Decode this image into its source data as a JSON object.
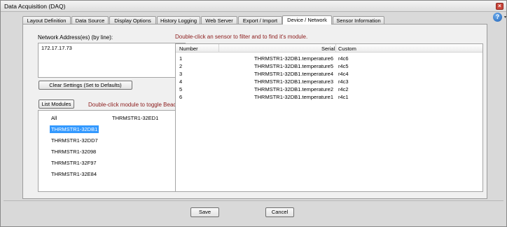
{
  "window": {
    "title": "Data Acquisition (DAQ)",
    "close_glyph": "×",
    "help_glyph": "?",
    "help_caret": "▾"
  },
  "tabs": [
    {
      "label": "Layout Definition"
    },
    {
      "label": "Data Source"
    },
    {
      "label": "Display Options"
    },
    {
      "label": "History Logging"
    },
    {
      "label": "Web Server"
    },
    {
      "label": "Export / Import"
    },
    {
      "label": "Device / Network",
      "active": true
    },
    {
      "label": "Sensor Information"
    }
  ],
  "network": {
    "label": "Network Address(es) (by line):",
    "value": "172.17.17.73",
    "clear_button": "Clear Settings (Set to Defaults)"
  },
  "modules": {
    "list_button": "List Modules",
    "hint": "Double-click module to toggle Beacon.",
    "items_col1": [
      "All",
      "THRMSTR1-32DB1",
      "THRMSTR1-32DD7",
      "THRMSTR1-32098",
      "THRMSTR1-32F97",
      "THRMSTR1-32E84"
    ],
    "items_col2": [
      "THRMSTR1-32ED1"
    ],
    "selected": "THRMSTR1-32DB1"
  },
  "sensors": {
    "hint": "Double-click an sensor to filter and to find it's module.",
    "columns": [
      "Number",
      "Serial",
      "Custom"
    ],
    "rows": [
      {
        "number": "1",
        "serial": "THRMSTR1-32DB1.temperature6",
        "custom": "r4c6"
      },
      {
        "number": "2",
        "serial": "THRMSTR1-32DB1.temperature5",
        "custom": "r4c5"
      },
      {
        "number": "3",
        "serial": "THRMSTR1-32DB1.temperature4",
        "custom": "r4c4"
      },
      {
        "number": "4",
        "serial": "THRMSTR1-32DB1.temperature3",
        "custom": "r4c3"
      },
      {
        "number": "5",
        "serial": "THRMSTR1-32DB1.temperature2",
        "custom": "r4c2"
      },
      {
        "number": "6",
        "serial": "THRMSTR1-32DB1.temperature1",
        "custom": "r4c1"
      }
    ]
  },
  "footer": {
    "save": "Save",
    "cancel": "Cancel"
  },
  "colors": {
    "hint_text": "#8b1a1a",
    "selection": "#3399ff"
  }
}
